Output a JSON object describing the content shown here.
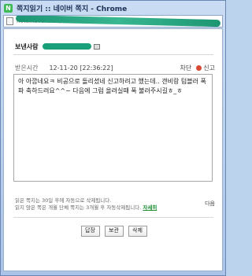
{
  "window": {
    "title": "쪽지읽기 :: 네이버 쪽지 - Chrome",
    "url": "note.naver.com/note/view.nhn?seq=…&tsd…"
  },
  "message": {
    "sender_label": "보낸사람",
    "time_label": "받은시간",
    "time_value": "12-11-20 [22:36:22]",
    "block_label": "차단",
    "report_label": "신고",
    "body": "아 아깝네요ㅋ 비공으로 돌리셨네 신고하려고 했는데.. 갠비랑 텀블러 폭파 축하드려요^^~ 다음에 그럼 올려실때 폭 불러주시길ㅎ_ㅎ"
  },
  "notice": {
    "line1": "읽은 쪽지는 30일 후에 자동으로 삭제됩니다.",
    "line2": "읽지 않은 쪽은 개월 단체 쪽지는 3개월 후 자동삭제됩니다.",
    "detail_link": "자세히",
    "next_link": "다음"
  },
  "buttons": {
    "reply": "답장",
    "save": "보관",
    "delete": "삭제"
  },
  "colors": {
    "mask_green": "#19a07a",
    "link_green": "#1b8d31"
  }
}
